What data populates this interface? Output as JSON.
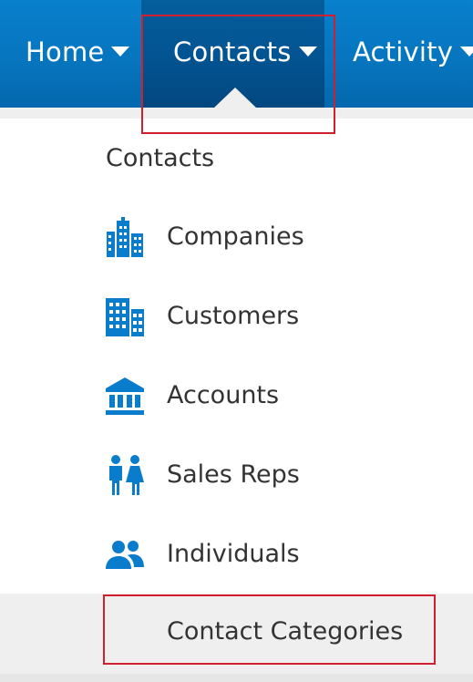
{
  "nav": {
    "items": [
      {
        "label": "Home"
      },
      {
        "label": "Contacts"
      },
      {
        "label": "Activity"
      }
    ],
    "active": "Contacts",
    "background_color": "#0775bf",
    "active_background_color": "#035290"
  },
  "menu": {
    "header": "Contacts",
    "items": [
      {
        "label": "Companies",
        "icon": "companies-building-icon"
      },
      {
        "label": "Customers",
        "icon": "customers-building-icon"
      },
      {
        "label": "Accounts",
        "icon": "bank-icon"
      },
      {
        "label": "Sales Reps",
        "icon": "people-pair-icon"
      },
      {
        "label": "Individuals",
        "icon": "group-icon"
      },
      {
        "label": "Contact Categories",
        "icon": ""
      }
    ],
    "selected": "Contact Categories",
    "icon_color": "#0a7ccc",
    "text_color": "#333333"
  },
  "annotations": {
    "highlight_color": "#d0202f"
  }
}
